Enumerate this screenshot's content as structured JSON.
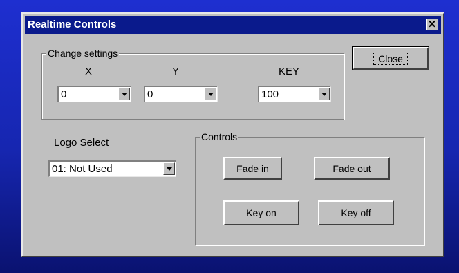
{
  "window": {
    "title": "Realtime Controls",
    "close_glyph": "✕"
  },
  "change_settings": {
    "label": "Change settings",
    "x_label": "X",
    "y_label": "Y",
    "key_label": "KEY",
    "x_value": "0",
    "y_value": "0",
    "key_value": "100"
  },
  "close_button": {
    "label": "Close"
  },
  "logo_select": {
    "label": "Logo Select",
    "value": "01:  Not Used"
  },
  "controls": {
    "label": "Controls",
    "fade_in": "Fade in",
    "fade_out": "Fade out",
    "key_on": "Key on",
    "key_off": "Key off"
  },
  "icons": [
    "close-icon",
    "chevron-down-icon"
  ],
  "colors": {
    "titlebar": "#0a1a8c",
    "dialog": "#c0c0c0",
    "desktop": "#1626b0"
  }
}
